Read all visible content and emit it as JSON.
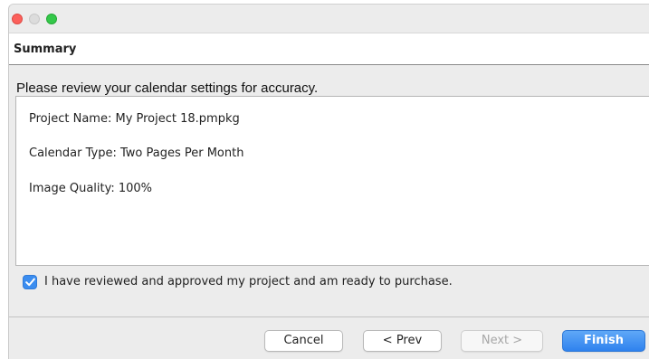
{
  "window": {
    "controls": [
      "close",
      "minimize",
      "zoom"
    ]
  },
  "header": {
    "title": "Summary"
  },
  "main": {
    "prompt": "Please review your calendar settings for accuracy.",
    "summary": {
      "project_name": "Project Name: My Project 18.pmpkg",
      "calendar_type": "Calendar Type: Two Pages Per Month",
      "image_quality": "Image Quality: 100%"
    },
    "approval": {
      "checked": true,
      "label": "I have reviewed and approved my project and am ready to purchase."
    }
  },
  "footer": {
    "cancel_label": "Cancel",
    "prev_label": "< Prev",
    "next_label": "Next >",
    "next_enabled": false,
    "finish_label": "Finish"
  },
  "colors": {
    "accent": "#3b8df0",
    "close": "#fc605b",
    "zoom": "#34c84a"
  },
  "icons": {
    "checkbox": "checkmark-icon"
  }
}
